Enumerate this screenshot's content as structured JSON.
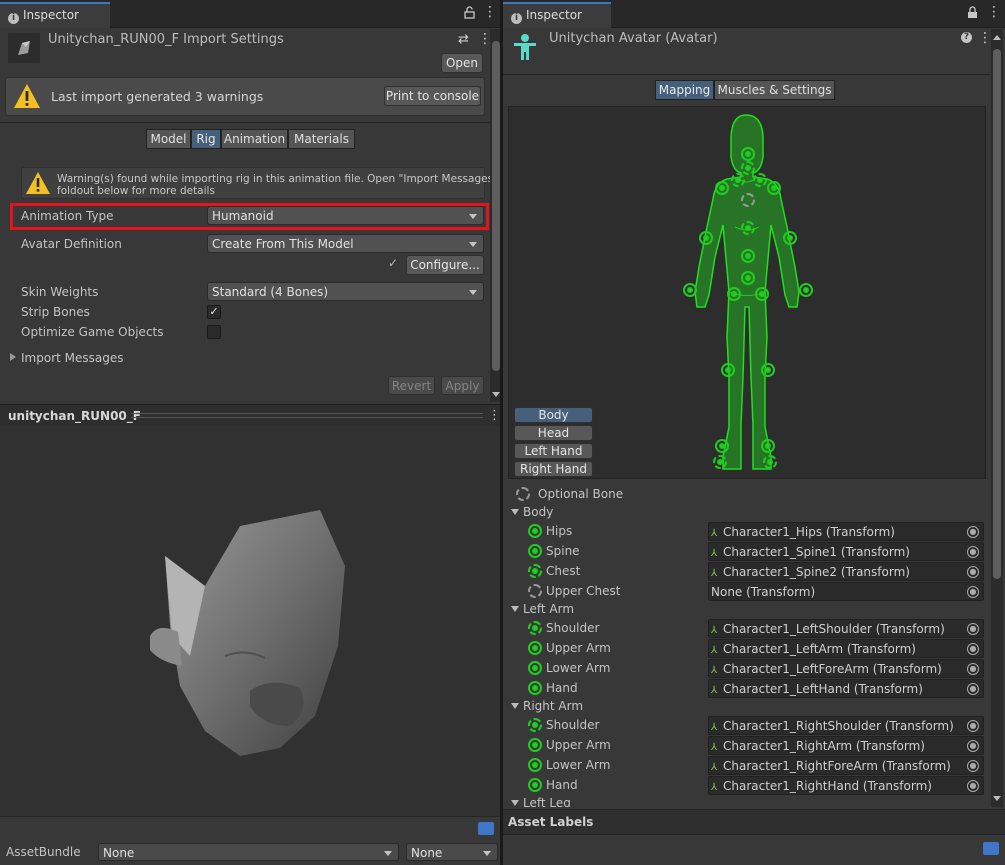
{
  "left_panel": {
    "tab_title": "Inspector",
    "asset_title": "Unitychan_RUN00_F Import Settings",
    "open_label": "Open",
    "warning_text": "Last import generated 3 warnings",
    "print_label": "Print to console",
    "tabs": [
      "Model",
      "Rig",
      "Animation",
      "Materials"
    ],
    "active_tab": "Rig",
    "rig_warning_line1": "Warning(s) found while importing rig in this animation file. Open \"Import Messages\"",
    "rig_warning_line2": "foldout below for more details",
    "animation_type_label": "Animation Type",
    "animation_type_value": "Humanoid",
    "avatar_def_label": "Avatar Definition",
    "avatar_def_value": "Create From This Model",
    "configure_label": "Configure...",
    "skin_weights_label": "Skin Weights",
    "skin_weights_value": "Standard (4 Bones)",
    "strip_bones_label": "Strip Bones",
    "strip_bones_checked": true,
    "optimize_label": "Optimize Game Objects",
    "optimize_checked": false,
    "import_messages_label": "Import Messages",
    "revert_label": "Revert",
    "apply_label": "Apply",
    "preview_title": "unitychan_RUN00_F",
    "asset_bundle_label": "AssetBundle",
    "asset_bundle_value": "None",
    "asset_bundle_variant": "None"
  },
  "right_panel": {
    "tab_title": "Inspector",
    "avatar_title": "Unitychan Avatar (Avatar)",
    "tabs": [
      "Mapping",
      "Muscles & Settings"
    ],
    "active_tab": "Mapping",
    "body_parts": [
      "Body",
      "Head",
      "Left Hand",
      "Right Hand"
    ],
    "active_body_part": "Body",
    "optional_bone_label": "Optional Bone",
    "groups": [
      {
        "name": "Body",
        "bones": [
          {
            "name": "Hips",
            "value": "Character1_Hips (Transform)",
            "kind": "solid"
          },
          {
            "name": "Spine",
            "value": "Character1_Spine1 (Transform)",
            "kind": "solid"
          },
          {
            "name": "Chest",
            "value": "Character1_Spine2 (Transform)",
            "kind": "dash"
          },
          {
            "name": "Upper Chest",
            "value": "None (Transform)",
            "kind": "opt"
          }
        ]
      },
      {
        "name": "Left Arm",
        "bones": [
          {
            "name": "Shoulder",
            "value": "Character1_LeftShoulder (Transform)",
            "kind": "dash"
          },
          {
            "name": "Upper Arm",
            "value": "Character1_LeftArm (Transform)",
            "kind": "solid"
          },
          {
            "name": "Lower Arm",
            "value": "Character1_LeftForeArm (Transform)",
            "kind": "solid"
          },
          {
            "name": "Hand",
            "value": "Character1_LeftHand (Transform)",
            "kind": "solid"
          }
        ]
      },
      {
        "name": "Right Arm",
        "bones": [
          {
            "name": "Shoulder",
            "value": "Character1_RightShoulder (Transform)",
            "kind": "dash"
          },
          {
            "name": "Upper Arm",
            "value": "Character1_RightArm (Transform)",
            "kind": "solid"
          },
          {
            "name": "Lower Arm",
            "value": "Character1_RightForeArm (Transform)",
            "kind": "solid"
          },
          {
            "name": "Hand",
            "value": "Character1_RightHand (Transform)",
            "kind": "solid"
          }
        ]
      }
    ],
    "next_group_label": "Left Leg",
    "asset_labels_title": "Asset Labels"
  },
  "colors": {
    "bone_green": "#1fcd1f",
    "highlight_red": "#e3141c",
    "active_tab_blue": "#46607c"
  },
  "icons": [
    "lock-icon",
    "menu-dots-icon",
    "warning-icon",
    "checkmark-icon",
    "chevron-down-icon",
    "avatar-figure-icon",
    "help-icon",
    "object-picker-icon",
    "tag-icon"
  ]
}
